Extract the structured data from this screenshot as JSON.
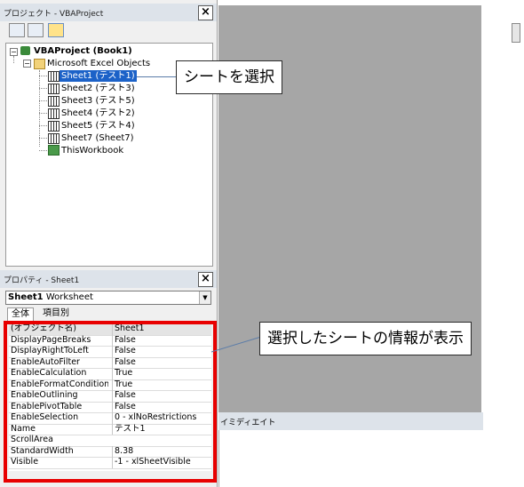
{
  "project_panel": {
    "title": "プロジェクト - VBAProject",
    "root": "VBAProject (Book1)",
    "folder": "Microsoft Excel Objects",
    "items": [
      "Sheet1 (テスト1)",
      "Sheet2 (テスト3)",
      "Sheet3 (テスト5)",
      "Sheet4 (テスト2)",
      "Sheet5 (テスト4)",
      "Sheet7 (Sheet7)",
      "ThisWorkbook"
    ]
  },
  "properties_panel": {
    "title": "プロパティ - Sheet1",
    "object_name": "Sheet1",
    "object_type": "Worksheet",
    "tabs": [
      "全体",
      "項目別"
    ],
    "rows": [
      {
        "k": "(オブジェクト名)",
        "v": "Sheet1"
      },
      {
        "k": "DisplayPageBreaks",
        "v": "False"
      },
      {
        "k": "DisplayRightToLeft",
        "v": "False"
      },
      {
        "k": "EnableAutoFilter",
        "v": "False"
      },
      {
        "k": "EnableCalculation",
        "v": "True"
      },
      {
        "k": "EnableFormatConditionsCa",
        "v": "True"
      },
      {
        "k": "EnableOutlining",
        "v": "False"
      },
      {
        "k": "EnablePivotTable",
        "v": "False"
      },
      {
        "k": "EnableSelection",
        "v": "0 - xlNoRestrictions"
      },
      {
        "k": "Name",
        "v": "テスト1"
      },
      {
        "k": "ScrollArea",
        "v": ""
      },
      {
        "k": "StandardWidth",
        "v": "8.38"
      },
      {
        "k": "Visible",
        "v": "-1 - xlSheetVisible"
      }
    ]
  },
  "immediate": {
    "title": "イミディエイト"
  },
  "annotations": {
    "callout1": "シートを選択",
    "callout2": "選択したシートの情報が表示"
  },
  "colors": {
    "highlight": "#e80000",
    "selection": "#1c62c8",
    "workspace": "#a6a6a6"
  }
}
